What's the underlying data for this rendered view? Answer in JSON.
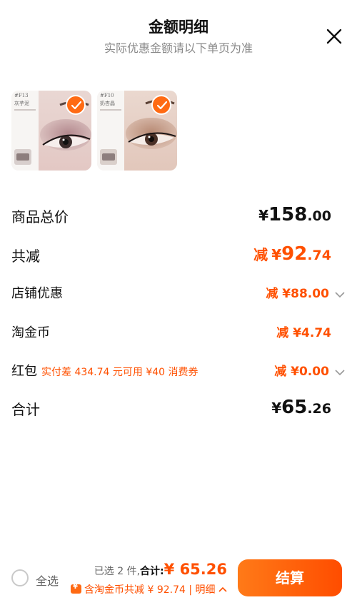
{
  "header": {
    "title": "金额明细",
    "subtitle": "实际优惠金额请以下单页为准"
  },
  "products": [
    {
      "code": "#F13",
      "name": "灰芋泥"
    },
    {
      "code": "#F10",
      "name": "奶杏晶"
    }
  ],
  "summary": {
    "total_label": "商品总价",
    "total_currency": "¥",
    "total_int": "158",
    "total_dec": ".00",
    "reduce_label": "共减",
    "reduce_prefix": "减",
    "reduce_currency": "¥",
    "reduce_int": "92",
    "reduce_dec": ".74",
    "shop_label": "店铺优惠",
    "shop_value": "减 ¥88.00",
    "coin_label": "淘金币",
    "coin_value": "减 ¥4.74",
    "redpacket_label": "红包",
    "redpacket_note": "实付差 434.74 元可用 ¥40 消费券",
    "redpacket_value": "减 ¥0.00",
    "sum_label": "合计",
    "sum_currency": "¥",
    "sum_int": "65",
    "sum_dec": ".26"
  },
  "footer": {
    "select_all": "全选",
    "selected_text": "已选 2 件,",
    "total_label": "合计:",
    "total_value": "¥ 65.26",
    "discount_text": "含淘金币共减 ¥ 92.74 | 明细",
    "checkout": "结算"
  },
  "colors": {
    "accent": "#ff5000",
    "check": "#ff6a13"
  }
}
